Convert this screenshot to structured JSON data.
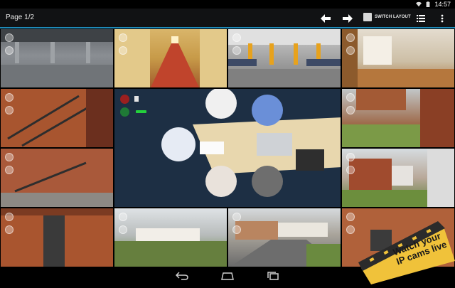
{
  "status_bar": {
    "time": "14:57"
  },
  "action_bar": {
    "page_label": "Page 1/2",
    "switch_layout_label": "SWITCH LAYOUT"
  },
  "promo": {
    "line1": "Watch your",
    "line2": "IP cams live"
  },
  "colors": {
    "accent": "#1f8ab8",
    "record": "#9b1f1f",
    "audio": "#1f7a36",
    "level": "#24d13c",
    "promo_yellow": "#f0c23a"
  },
  "icons": [
    "wifi-icon",
    "battery-icon",
    "arrow-left-icon",
    "arrow-right-icon",
    "list-icon",
    "overflow-menu-icon",
    "nav-back-icon",
    "nav-home-icon",
    "nav-recents-icon"
  ]
}
